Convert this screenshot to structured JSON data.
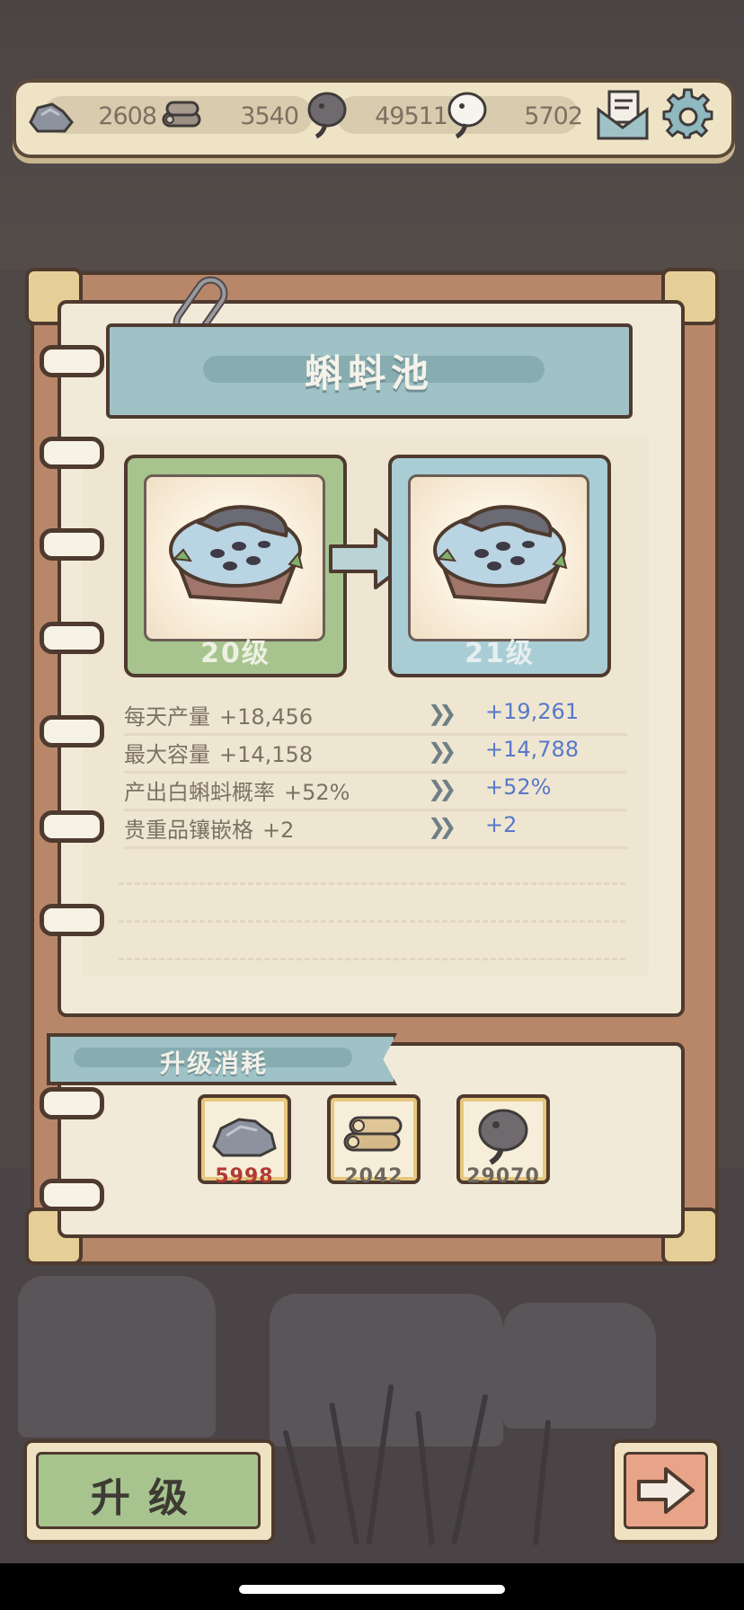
{
  "resources": [
    {
      "icon": "stone-icon",
      "value": "2608"
    },
    {
      "icon": "wood-icon",
      "value": "3540"
    },
    {
      "icon": "gray-tadpole-icon",
      "value": "49511"
    },
    {
      "icon": "white-tadpole-icon",
      "value": "5702"
    }
  ],
  "header_icons": [
    "mail-icon",
    "gear-icon"
  ],
  "building": {
    "title": "蝌蚪池",
    "current_level": "20级",
    "next_level": "21级"
  },
  "stats": [
    {
      "label": "每天产量",
      "current": "+18,456",
      "next": "+19,261"
    },
    {
      "label": "最大容量",
      "current": "+14,158",
      "next": "+14,788"
    },
    {
      "label": "产出白蝌蚪概率",
      "current": "+52%",
      "next": "+52%"
    },
    {
      "label": "贵重品镶嵌格",
      "current": "+2",
      "next": "+2"
    }
  ],
  "cost": {
    "title": "升级消耗",
    "items": [
      {
        "icon": "stone-icon",
        "amount": "5998",
        "color": "#b23a34"
      },
      {
        "icon": "wood-icon",
        "amount": "2042",
        "color": "#6e675f"
      },
      {
        "icon": "gray-tadpole-icon",
        "amount": "29070",
        "color": "#6e675f"
      }
    ]
  },
  "buttons": {
    "upgrade_label": "升级",
    "next_icon": "arrow-right-icon"
  },
  "colors": {
    "current_card": "#a7c48e",
    "next_card": "#a9cdd4",
    "next_value": "#5978c8"
  }
}
